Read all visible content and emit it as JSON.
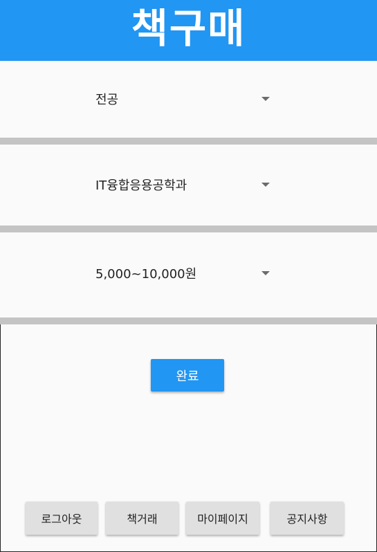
{
  "header": {
    "title": "책구매"
  },
  "filters": {
    "major": {
      "value": "전공",
      "icon": "dropdown-arrow-icon"
    },
    "department": {
      "value": "IT융합응용공학과",
      "icon": "dropdown-arrow-icon"
    },
    "price": {
      "value": "5,000~10,000원",
      "icon": "dropdown-arrow-icon"
    }
  },
  "submit_label": "완료",
  "bottom_nav": {
    "logout_label": "로그아웃",
    "book_trade_label": "책거래",
    "mypage_label": "마이페이지",
    "notice_label": "공지사항"
  },
  "colors": {
    "primary": "#2196f3",
    "divider": "#c4c4c4",
    "background": "#fafafa",
    "nav_button": "#e0e0e0"
  }
}
